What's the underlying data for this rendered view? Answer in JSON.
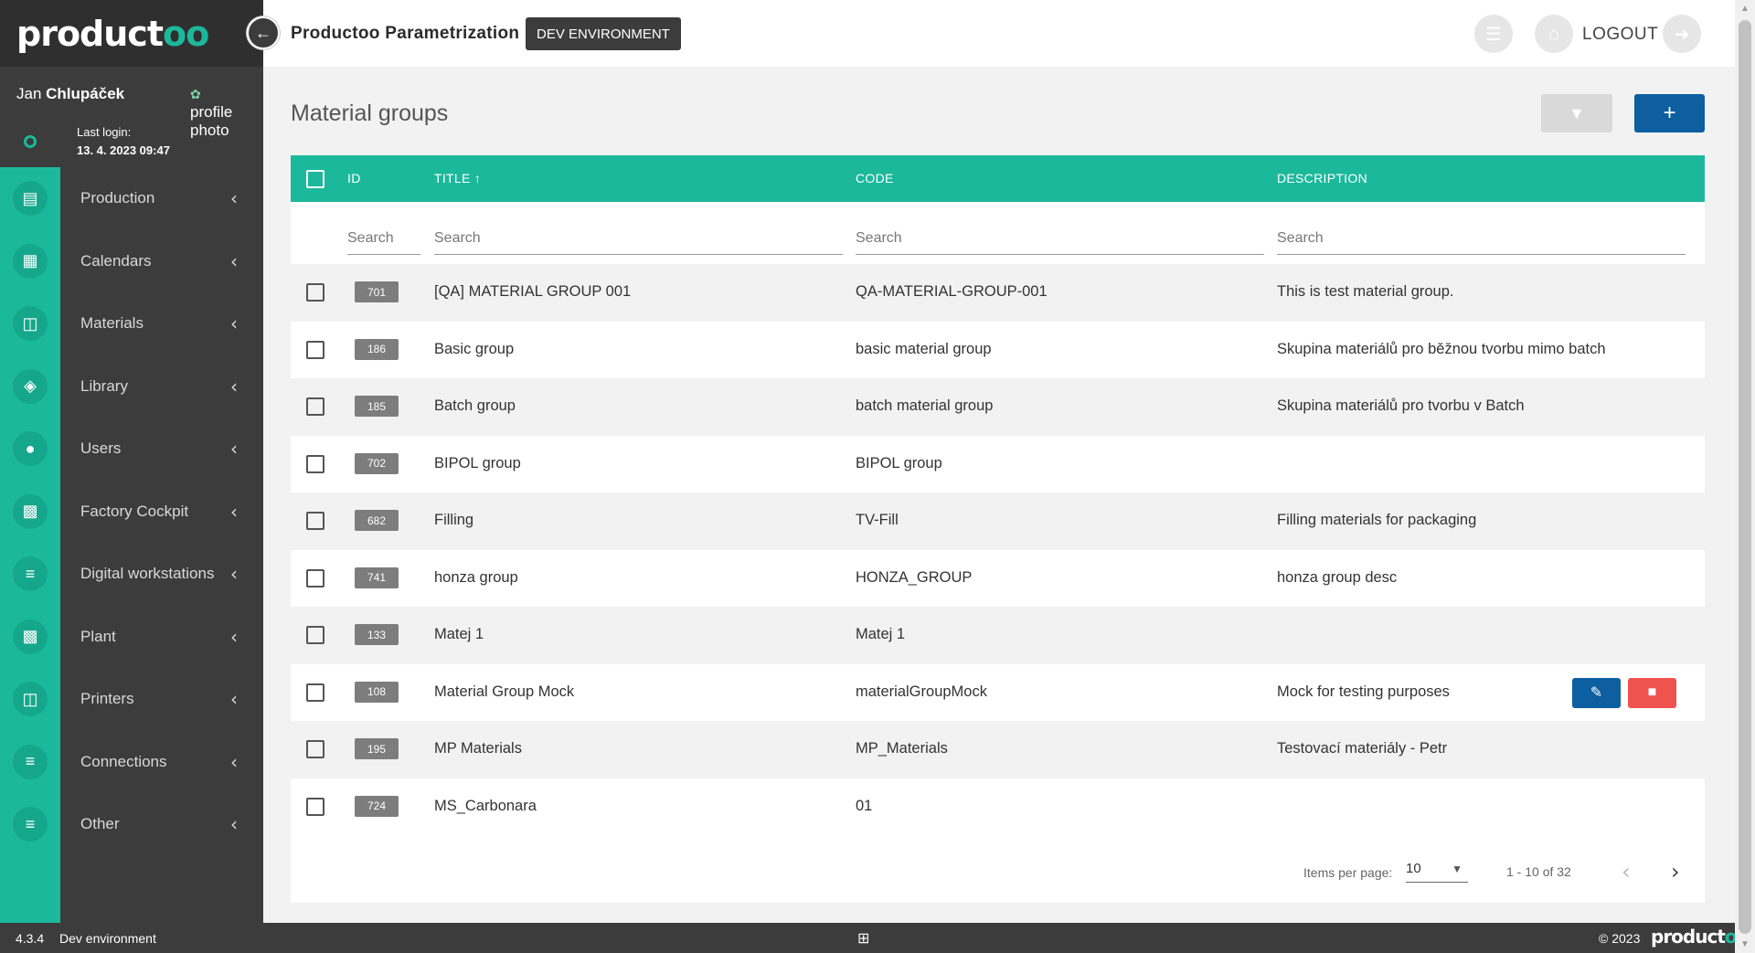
{
  "sidebar": {
    "logo_main": "product",
    "logo_accent": "oo",
    "user_first": "Jan ",
    "user_last": "Chlupáček",
    "profile_photo_alt": "profile photo",
    "last_login_label": "Last login:",
    "last_login_date": "13. 4. 2023 09:47",
    "items": [
      {
        "label": "Production",
        "icon": "production-icon"
      },
      {
        "label": "Calendars",
        "icon": "calendar-icon"
      },
      {
        "label": "Materials",
        "icon": "folder-icon"
      },
      {
        "label": "Library",
        "icon": "tag-icon"
      },
      {
        "label": "Users",
        "icon": "users-icon"
      },
      {
        "label": "Factory Cockpit",
        "icon": "factory-icon"
      },
      {
        "label": "Digital workstations",
        "icon": "list-icon"
      },
      {
        "label": "Plant",
        "icon": "factory-icon"
      },
      {
        "label": "Printers",
        "icon": "folder-icon"
      },
      {
        "label": "Connections",
        "icon": "list-icon"
      },
      {
        "label": "Other",
        "icon": "list-icon"
      }
    ]
  },
  "header": {
    "title": "Productoo Parametrization",
    "env_badge": "DEV ENVIRONMENT",
    "logout_label": "LOGOUT"
  },
  "main": {
    "page_title": "Material groups",
    "columns": {
      "id": "ID",
      "title": "TITLE",
      "code": "CODE",
      "description": "DESCRIPTION"
    },
    "search_placeholder": "Search",
    "rows": [
      {
        "id": "701",
        "title": "[QA] MATERIAL GROUP 001",
        "code": "QA-MATERIAL-GROUP-001",
        "description": "This is test material group."
      },
      {
        "id": "186",
        "title": "Basic group",
        "code": "basic material group",
        "description": "Skupina materiálů pro běžnou tvorbu mimo batch"
      },
      {
        "id": "185",
        "title": "Batch group",
        "code": "batch material group",
        "description": "Skupina materiálů pro tvorbu v Batch"
      },
      {
        "id": "702",
        "title": "BIPOL group",
        "code": "BIPOL group",
        "description": ""
      },
      {
        "id": "682",
        "title": "Filling",
        "code": "TV-Fill",
        "description": "Filling materials for packaging"
      },
      {
        "id": "741",
        "title": "honza group",
        "code": "HONZA_GROUP",
        "description": "honza group desc"
      },
      {
        "id": "133",
        "title": "Matej 1",
        "code": "Matej 1",
        "description": ""
      },
      {
        "id": "108",
        "title": "Material Group Mock",
        "code": "materialGroupMock",
        "description": "Mock for testing purposes"
      },
      {
        "id": "195",
        "title": "MP Materials",
        "code": "MP_Materials",
        "description": "Testovací materiály - Petr"
      },
      {
        "id": "724",
        "title": "MS_Carbonara",
        "code": "01",
        "description": ""
      }
    ],
    "paginator": {
      "items_per_page_label": "Items per page:",
      "items_per_page": "10",
      "range": "1 - 10 of 32"
    }
  },
  "footer": {
    "version": "4.3.4",
    "environment": "Dev environment",
    "copyright": "© 2023",
    "logo_main": "product",
    "logo_accent": "oo"
  },
  "colors": {
    "accent": "#1cb89b",
    "sidebar": "#3c3c3c",
    "primary_button": "#0d5fa0",
    "danger_button": "#ef5350"
  }
}
